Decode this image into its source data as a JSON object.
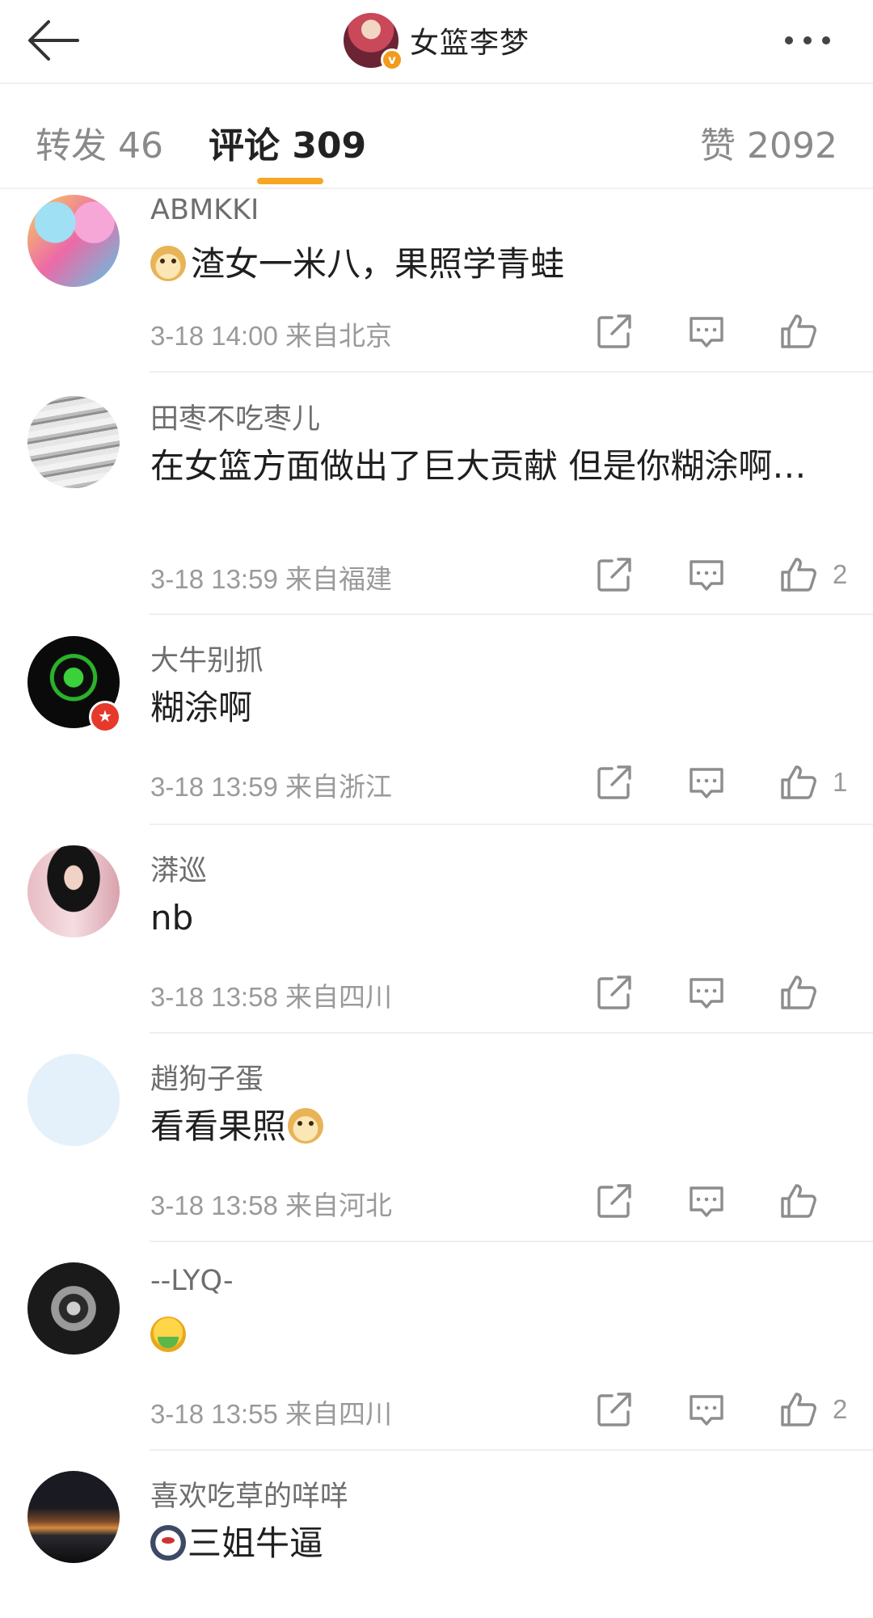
{
  "header": {
    "title": "女篮李梦"
  },
  "tabs": {
    "repost": "转发 46",
    "comment": "评论 309",
    "like": "赞 2092"
  },
  "comments": [
    {
      "username": "ABMKKI",
      "text": "渣女一米八，果照学青蛙",
      "emoji": "doge-emoji",
      "time": "3-18 14:00",
      "location": "来自北京",
      "likes": "",
      "avatar_colors": [
        "#f5c542",
        "#e8529a",
        "#53c6e0"
      ]
    },
    {
      "username": "田枣不吃枣儿",
      "text": "在女篮方面做出了巨大贡献 但是你糊涂啊…",
      "time": "3-18 13:59",
      "location": "来自福建",
      "likes": "2",
      "avatar_colors": [
        "#d9d9d9",
        "#9e9e9e",
        "#efefef"
      ]
    },
    {
      "username": "大牛别抓",
      "text": "糊涂啊",
      "time": "3-18 13:59",
      "location": "来自浙江",
      "likes": "1",
      "avatar_colors": [
        "#0c0c0c",
        "#3cd13c",
        "#1a5a1a"
      ]
    },
    {
      "username": "漭巡",
      "text": "nb",
      "time": "3-18 13:58",
      "location": "来自四川",
      "likes": "",
      "avatar_colors": [
        "#f2d5da",
        "#1a1a1a",
        "#c98a93"
      ]
    },
    {
      "username": "趙狗子蛋",
      "text": "看看果照",
      "emoji_after": "doge-emoji",
      "time": "3-18 13:58",
      "location": "来自河北",
      "likes": "",
      "avatar_colors": [
        "#e3f0f9",
        "#e3f0f9",
        "#d5e7f4"
      ]
    },
    {
      "username": "--LYQ-",
      "text": "",
      "emoji": "sick-emoji",
      "time": "3-18 13:55",
      "location": "来自四川",
      "likes": "2",
      "avatar_colors": [
        "#111111",
        "#8c8c8c",
        "#3a3a3a"
      ]
    },
    {
      "username": "喜欢吃草的咩咩",
      "text": "三姐牛逼",
      "emoji": "panda-emoji",
      "time": "",
      "location": "",
      "likes": "",
      "avatar_colors": [
        "#0f0f12",
        "#c97a3a",
        "#2b2b33"
      ]
    }
  ]
}
